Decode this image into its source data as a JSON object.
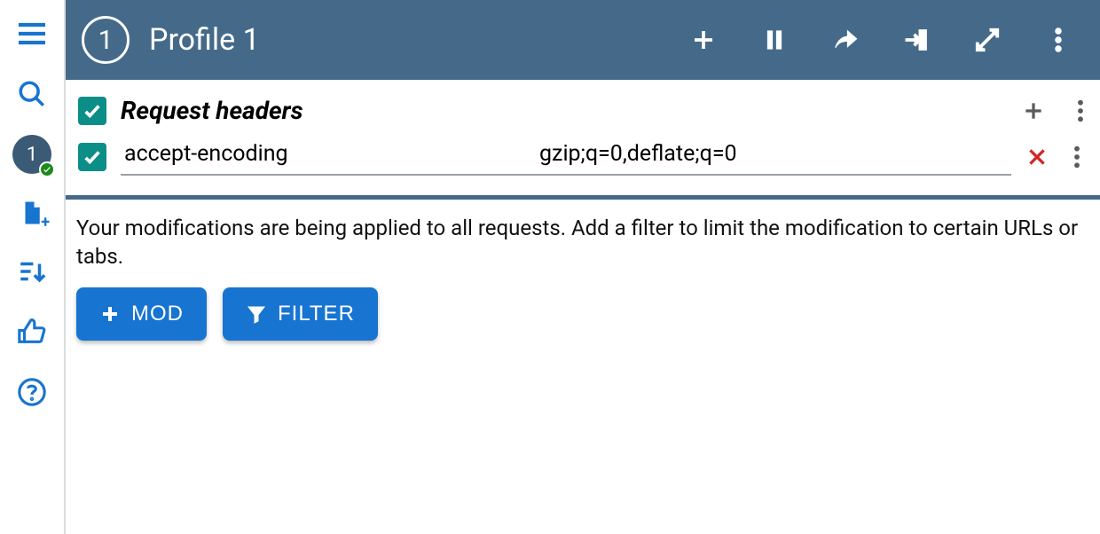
{
  "header": {
    "profile_number": "1",
    "title": "Profile 1"
  },
  "sidebar": {
    "active_profile_number": "1"
  },
  "section": {
    "title": "Request headers",
    "checked": true
  },
  "headers": [
    {
      "checked": true,
      "name": "accept-encoding",
      "value": "gzip;q=0,deflate;q=0"
    }
  ],
  "info": {
    "text": "Your modifications are being applied to all requests. Add a filter to limit the modification to certain URLs or tabs.",
    "mod_button": "MOD",
    "filter_button": "FILTER"
  }
}
